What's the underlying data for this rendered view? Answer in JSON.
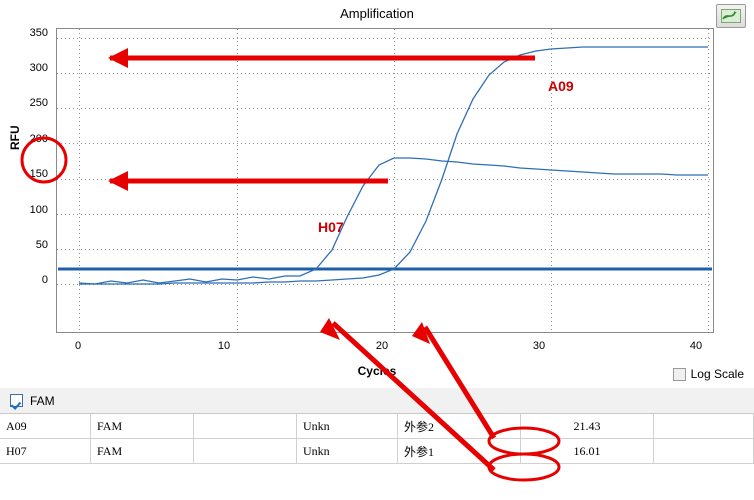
{
  "chart": {
    "title": "Amplification",
    "maximize_icon": "maximize-chart-icon",
    "log_scale_label": "Log Scale",
    "log_scale_checked": false
  },
  "chart_data": {
    "type": "line",
    "title": "Amplification",
    "xlabel": "Cycles",
    "ylabel": "RFU",
    "xlim": [
      0,
      41
    ],
    "ylim": [
      -12,
      355
    ],
    "xticks": [
      0,
      10,
      20,
      30,
      40
    ],
    "yticks": [
      0,
      50,
      100,
      150,
      200,
      250,
      300,
      350
    ],
    "grid": true,
    "legend_position": "inline-annotations",
    "threshold": {
      "label": "threshold",
      "value": 22,
      "color": "#1f5fa8"
    },
    "series": [
      {
        "name": "A09",
        "color": "#2f6eb5",
        "label_position": {
          "x": 20,
          "y": 182
        },
        "x": [
          1,
          2,
          3,
          4,
          5,
          6,
          7,
          8,
          9,
          10,
          11,
          12,
          13,
          14,
          15,
          16,
          17,
          18,
          19,
          20,
          21,
          22,
          23,
          24,
          25,
          26,
          27,
          28,
          29,
          30,
          31,
          32,
          33,
          34,
          35,
          36,
          37,
          38,
          39,
          40
        ],
        "y": [
          2,
          2,
          2,
          2,
          2,
          2,
          3,
          3,
          3,
          3,
          3,
          3,
          3,
          3,
          4,
          4,
          5,
          6,
          8,
          12,
          22,
          45,
          90,
          150,
          215,
          265,
          300,
          320,
          330,
          335,
          337,
          338,
          339,
          339,
          339,
          339,
          339,
          339,
          339,
          339
        ]
      },
      {
        "name": "H07",
        "color": "#2f6eb5",
        "label_position": {
          "x": 16,
          "y": 112
        },
        "x": [
          1,
          2,
          3,
          4,
          5,
          6,
          7,
          8,
          9,
          10,
          11,
          12,
          13,
          14,
          15,
          16,
          17,
          18,
          19,
          20,
          21,
          22,
          23,
          24,
          25,
          26,
          27,
          28,
          29,
          30,
          31,
          32,
          33,
          34,
          35,
          36,
          37,
          38,
          39,
          40
        ],
        "y": [
          3,
          2,
          4,
          3,
          5,
          3,
          4,
          6,
          4,
          6,
          5,
          7,
          6,
          8,
          12,
          22,
          48,
          95,
          140,
          170,
          180,
          180,
          178,
          175,
          172,
          170,
          168,
          166,
          163,
          161,
          160,
          158,
          157,
          156,
          155,
          155,
          155,
          155,
          155,
          154
        ]
      }
    ],
    "annotations": [
      {
        "type": "arrow",
        "note": "arrow pointing to y=340 plateau",
        "to_x": 3,
        "to_y": 340
      },
      {
        "type": "arrow",
        "note": "arrow pointing to y=180 plateau",
        "to_x": 3,
        "to_y": 180
      },
      {
        "type": "ellipse",
        "note": "circle around y tick 200",
        "label": "200"
      },
      {
        "type": "arrow",
        "note": "arrow from Cq cell 21.43 to curve at cycle 22"
      },
      {
        "type": "arrow",
        "note": "arrow from Cq cell 16.01 to curve at cycle 16"
      },
      {
        "type": "ellipse",
        "note": "circle around Cq value 21.43"
      },
      {
        "type": "ellipse",
        "note": "circle around Cq value 16.01"
      }
    ]
  },
  "table": {
    "fluorophore_label": "FAM",
    "fluorophore_checked": true,
    "rows": [
      {
        "well": "A09",
        "fluor": "FAM",
        "blank": "",
        "type": "Unkn",
        "name": "外参2",
        "cq": "21.43"
      },
      {
        "well": "H07",
        "fluor": "FAM",
        "blank": "",
        "type": "Unkn",
        "name": "外参1",
        "cq": "16.01"
      }
    ]
  }
}
